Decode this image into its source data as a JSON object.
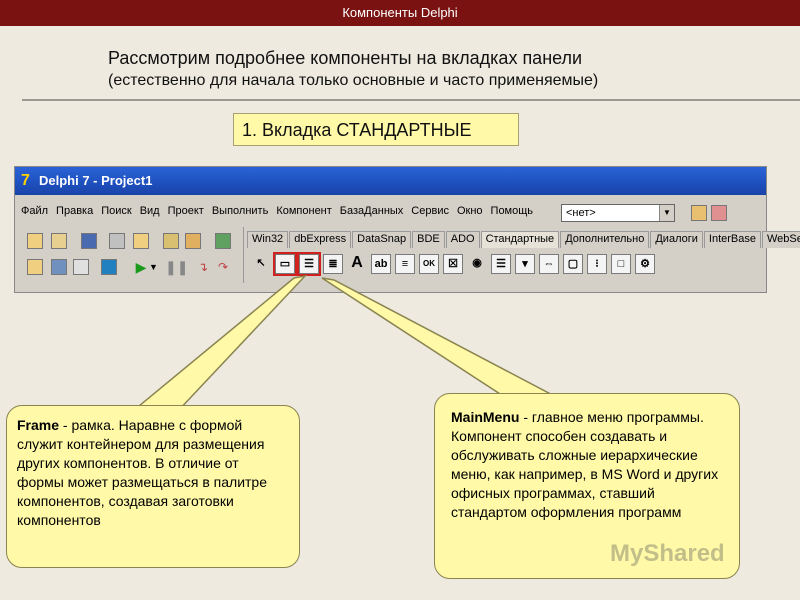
{
  "top_bar": {
    "title": "Компоненты Delphi"
  },
  "heading": {
    "line1": "Рассмотрим подробнее компоненты на вкладках панели",
    "line2": "(естественно для начала только основные и часто применяемые)"
  },
  "tab_title": "1. Вкладка СТАНДАРТНЫЕ",
  "delphi": {
    "window_title": "Delphi 7 - Project1",
    "menu": [
      "Файл",
      "Правка",
      "Поиск",
      "Вид",
      "Проект",
      "Выполнить",
      "Компонент",
      "БазаДанных",
      "Сервис",
      "Окно",
      "Помощь"
    ],
    "combo_value": "<нет>",
    "tabs": [
      "Win32",
      "dbExpress",
      "DataSnap",
      "BDE",
      "ADO",
      "Стандартные",
      "Дополнительно",
      "Диалоги",
      "InterBase",
      "WebSe"
    ]
  },
  "callouts": {
    "frame": {
      "title": "Frame",
      "text": " - рамка. Наравне с формой служит контейнером для размещения других компонентов. В отличие от формы может размещаться в палитре компонентов, создавая заготовки компонентов"
    },
    "mainmenu": {
      "title": "MainMenu",
      "text": " - главное меню программы. Компонент способен создавать и обслуживать сложные иерархические меню, как например, в MS Word и других офисных программах, ставший стандартом оформления программ"
    }
  },
  "watermark": "MyShared"
}
